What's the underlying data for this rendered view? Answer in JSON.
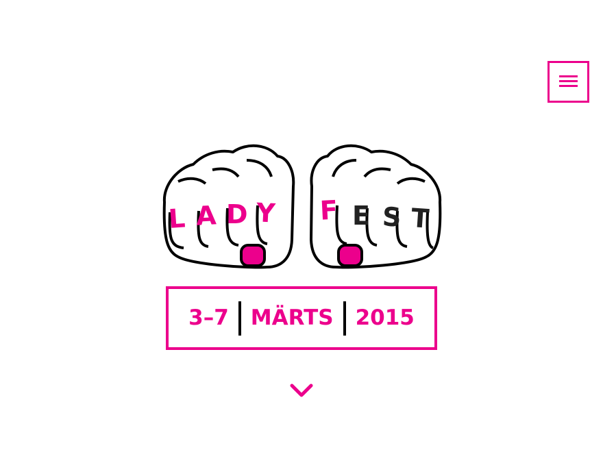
{
  "colors": {
    "accent": "#ec008c",
    "ink": "#000000",
    "background": "#ffffff",
    "dark_letter": "#222222"
  },
  "header": {
    "menu_icon": "hamburger-menu-icon"
  },
  "logo": {
    "left_fist": [
      "L",
      "A",
      "D",
      "Y"
    ],
    "right_fist": [
      "F",
      "E",
      "S",
      "T"
    ]
  },
  "event": {
    "days": "3–7",
    "month": "MÄRTS",
    "year": "2015"
  },
  "scroll": {
    "icon": "chevron-down-icon"
  }
}
